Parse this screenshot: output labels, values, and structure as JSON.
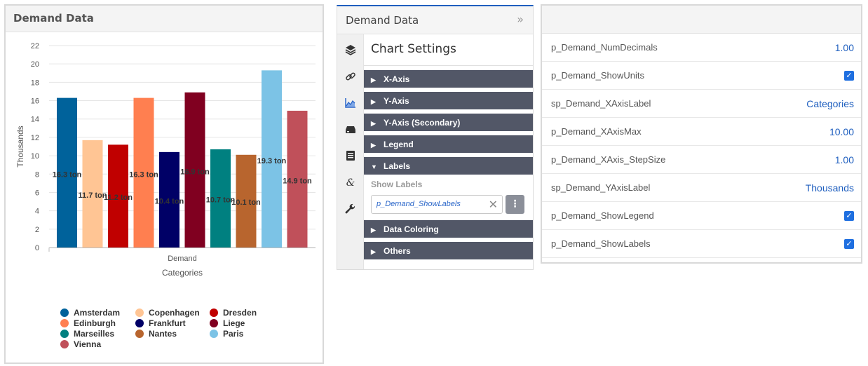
{
  "chart_widget": {
    "title": "Demand Data"
  },
  "chart_data": {
    "type": "bar",
    "categories": [
      "Demand"
    ],
    "series": [
      {
        "name": "Amsterdam",
        "values": [
          16.3
        ],
        "label": "16.3 ton",
        "color": "#00629b"
      },
      {
        "name": "Copenhagen",
        "values": [
          11.7
        ],
        "label": "11.7 ton",
        "color": "#ffc594"
      },
      {
        "name": "Dresden",
        "values": [
          11.2
        ],
        "label": "11.2 ton",
        "color": "#c00000"
      },
      {
        "name": "Edinburgh",
        "values": [
          16.3
        ],
        "label": "16.3 ton",
        "color": "#ff7f50"
      },
      {
        "name": "Frankfurt",
        "values": [
          10.4
        ],
        "label": "10.4 ton",
        "color": "#000066"
      },
      {
        "name": "Liege",
        "values": [
          16.9
        ],
        "label": "16.9 ton",
        "color": "#800020"
      },
      {
        "name": "Marseilles",
        "values": [
          10.7
        ],
        "label": "10.7 ton",
        "color": "#008080"
      },
      {
        "name": "Nantes",
        "values": [
          10.1
        ],
        "label": "10.1 ton",
        "color": "#b8652e"
      },
      {
        "name": "Paris",
        "values": [
          19.3
        ],
        "label": "19.3 ton",
        "color": "#7cc3e6"
      },
      {
        "name": "Vienna",
        "values": [
          14.9
        ],
        "label": "14.9 ton",
        "color": "#c0505a"
      }
    ],
    "ylim": [
      0,
      22
    ],
    "yticks": [
      "0",
      "2",
      "4",
      "6",
      "8",
      "10",
      "12",
      "14",
      "16",
      "18",
      "20",
      "22"
    ],
    "xlabel": "Categories",
    "ylabel": "Thousands",
    "grid": true,
    "legend_placement": "bottom"
  },
  "settings_panel": {
    "title": "Demand Data",
    "collapse_glyph": "»",
    "settings_title": "Chart Settings",
    "rail_icons": [
      "layers-icon",
      "link-icon",
      "chart-icon",
      "database-icon",
      "table-icon",
      "ampersand-icon",
      "wrench-icon"
    ],
    "sections": [
      {
        "label": "X-Axis",
        "expanded": false
      },
      {
        "label": "Y-Axis",
        "expanded": false
      },
      {
        "label": "Y-Axis (Secondary)",
        "expanded": false
      },
      {
        "label": "Legend",
        "expanded": false
      },
      {
        "label": "Labels",
        "expanded": true
      },
      {
        "label": "Data Coloring",
        "expanded": false
      },
      {
        "label": "Others",
        "expanded": false
      }
    ],
    "show_labels_label": "Show Labels",
    "show_labels_value": "p_Demand_ShowLabels"
  },
  "param_panel": {
    "rows": [
      {
        "name": "p_Demand_NumDecimals",
        "value": "1.00",
        "kind": "text"
      },
      {
        "name": "p_Demand_ShowUnits",
        "value": "checked",
        "kind": "checkbox"
      },
      {
        "name": "sp_Demand_XAxisLabel",
        "value": "Categories",
        "kind": "text"
      },
      {
        "name": "p_Demand_XAxisMax",
        "value": "10.00",
        "kind": "text"
      },
      {
        "name": "p_Demand_XAxis_StepSize",
        "value": "1.00",
        "kind": "text"
      },
      {
        "name": "sp_Demand_YAxisLabel",
        "value": "Thousands",
        "kind": "text"
      },
      {
        "name": "p_Demand_ShowLegend",
        "value": "checked",
        "kind": "checkbox"
      },
      {
        "name": "p_Demand_ShowLabels",
        "value": "checked",
        "kind": "checkbox"
      }
    ]
  }
}
